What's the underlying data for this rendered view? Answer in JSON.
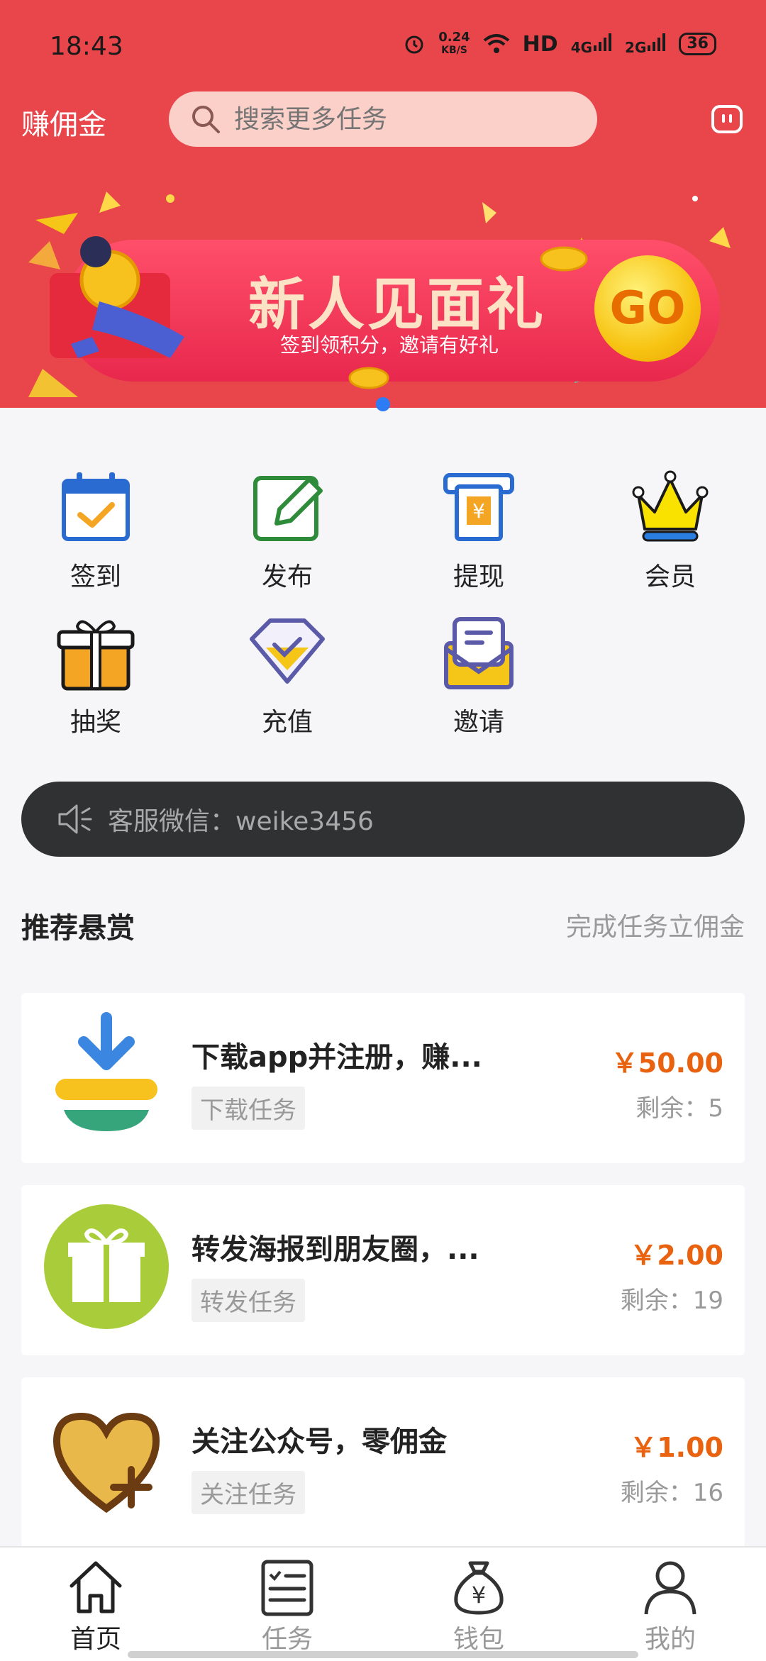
{
  "status_bar": {
    "time": "18:43",
    "net_speed_value": "0.24",
    "net_speed_unit": "KB/S",
    "hd_label": "HD",
    "sim1_label": "4G",
    "sim2_label": "2G",
    "battery": "36"
  },
  "header": {
    "title": "赚佣金",
    "search_placeholder": "搜索更多任务"
  },
  "banner": {
    "title": "新人见面礼",
    "subtitle": "签到领积分，邀请有好礼",
    "go_label": "GO"
  },
  "grid_menu": [
    {
      "label": "签到"
    },
    {
      "label": "发布"
    },
    {
      "label": "提现"
    },
    {
      "label": "会员"
    },
    {
      "label": "抽奖"
    },
    {
      "label": "充值"
    },
    {
      "label": "邀请"
    }
  ],
  "notice": {
    "text": "客服微信：weike3456"
  },
  "section": {
    "title": "推荐悬赏",
    "more": "完成任务立佣金"
  },
  "tasks": [
    {
      "title": "下载app并注册，赚...",
      "tag": "下载任务",
      "price": "￥50.00",
      "remaining": "剩余：5"
    },
    {
      "title": "转发海报到朋友圈，...",
      "tag": "转发任务",
      "price": "￥2.00",
      "remaining": "剩余：19"
    },
    {
      "title": "关注公众号，零佣金",
      "tag": "关注任务",
      "price": "￥1.00",
      "remaining": "剩余：16"
    }
  ],
  "tabbar": [
    {
      "label": "首页",
      "active": true
    },
    {
      "label": "任务",
      "active": false
    },
    {
      "label": "钱包",
      "active": false
    },
    {
      "label": "我的",
      "active": false
    }
  ],
  "colors": {
    "header_bg": "#e9464c",
    "price": "#e8620f",
    "notice_bg": "#303133",
    "indicator": "#2d7cf6"
  }
}
